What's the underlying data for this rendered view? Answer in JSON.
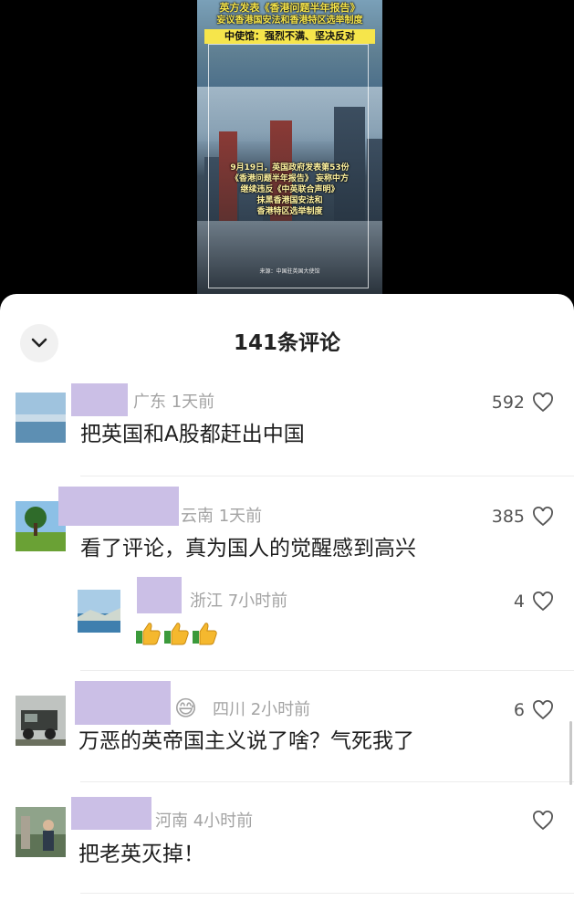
{
  "video": {
    "headline_1": "英方发表《香港问题半年报告》",
    "headline_2": "妄议香港国安法和香港特区选举制度",
    "headline_3": "中使馆：强烈不满、坚决反对",
    "body_line_1": "9月19日，英国政府发表第53份",
    "body_line_2": "《香港问题半年报告》 妄称中方",
    "body_line_3": "继续违反《中英联合声明》",
    "body_line_4": "抹黑香港国安法和",
    "body_line_5": "香港特区选举制度",
    "source": "来源：中国驻英国大使馆"
  },
  "sheet": {
    "title": "141条评论",
    "collapse_icon": "chevron-down-icon"
  },
  "comments": [
    {
      "location_time": "广东 1天前",
      "text": "把英国和A股都赶出中国",
      "likes": "592"
    },
    {
      "location_time": "云南 1天前",
      "text": "看了评论，真为国人的觉醒感到高兴",
      "likes": "385"
    },
    {
      "location_time": "浙江 7小时前",
      "text": "👍👍👍",
      "likes": "4"
    },
    {
      "location_time": "四川 2小时前",
      "text": "万恶的英帝国主义说了啥？气死我了",
      "likes": "6",
      "emoji": "😅"
    },
    {
      "location_time": "河南 4小时前",
      "text": "把老英灭掉！",
      "likes": ""
    }
  ],
  "colors": {
    "redaction": "#cbbfe6",
    "meta": "#a3a3a3",
    "headline": "#f6e54b"
  }
}
